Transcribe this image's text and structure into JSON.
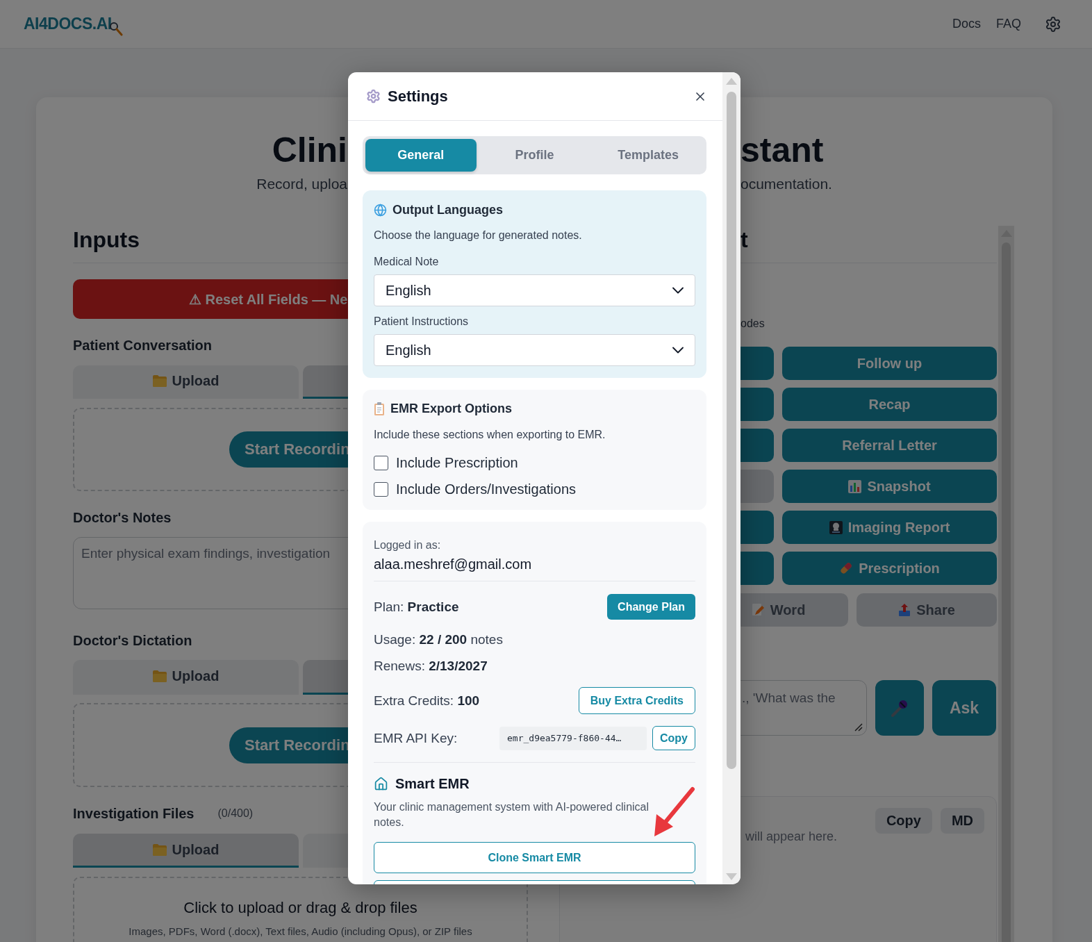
{
  "header": {
    "logo": "AI4DOCS.AI",
    "nav": [
      "Docs",
      "FAQ"
    ]
  },
  "page": {
    "title_left": "Clini",
    "title_right": "stant",
    "subtitle_left": "Record, uploa",
    "subtitle_right": "ocumentation."
  },
  "inputs": {
    "heading": "Inputs",
    "reset_button": "⚠ Reset All Fields — Ne",
    "sections": [
      {
        "kind": "recorder",
        "title": "Patient Conversation",
        "tabs": [
          {
            "label": "Upload",
            "selected": false
          },
          {
            "selected": true
          }
        ],
        "record_button": "Start Recordin"
      },
      {
        "kind": "notes",
        "title": "Doctor's Notes",
        "placeholder": "Enter physical exam findings, investigation"
      },
      {
        "kind": "recorder",
        "title": "Doctor's Dictation",
        "tabs": [
          {
            "label": "Upload",
            "selected": false
          },
          {
            "selected": true
          }
        ],
        "record_button": "Start Recordin"
      },
      {
        "kind": "files",
        "title": "Investigation Files",
        "count": "(0/400)",
        "tabs": [
          {
            "label": "Upload",
            "selected": true
          },
          {
            "selected": false
          }
        ],
        "drop_title": "Click to upload or drag & drop files",
        "drop_hint": "Images, PDFs, Word (.docx), Text files, Audio (including Opus), or ZIP files"
      }
    ]
  },
  "output": {
    "heading": "t",
    "modes_label": "odes",
    "note_buttons": [
      {
        "disabled": false
      },
      {
        "label": "Follow up",
        "disabled": false
      },
      {
        "disabled": false
      },
      {
        "label": "Recap",
        "disabled": false
      },
      {
        "disabled": false
      },
      {
        "label": "Referral Letter",
        "disabled": false
      },
      {
        "disabled": true
      },
      {
        "label": "Snapshot",
        "disabled": false
      },
      {
        "disabled": false
      },
      {
        "label": "Imaging Report",
        "disabled": false
      },
      {
        "disabled": false
      },
      {
        "label": "Prescription",
        "disabled": false
      }
    ],
    "export_buttons": [
      {
        "label": "Word",
        "disabled": true
      },
      {
        "label": "Share",
        "disabled": true
      }
    ],
    "question_placeholder": "., 'What was the",
    "ask_button": "Ask",
    "answer": {
      "placeholder": "will appear here.",
      "buttons": [
        "Copy",
        "MD"
      ]
    }
  },
  "settings": {
    "title": "Settings",
    "tabs": [
      {
        "label": "General",
        "selected": true
      },
      {
        "label": "Profile",
        "selected": false
      },
      {
        "label": "Templates",
        "selected": false
      }
    ],
    "languages": {
      "title": "Output Languages",
      "description": "Choose the language for generated notes.",
      "fields": [
        {
          "label": "Medical Note",
          "value": "English"
        },
        {
          "label": "Patient Instructions",
          "value": "English"
        }
      ]
    },
    "emr_export": {
      "title": "EMR Export Options",
      "description": "Include these sections when exporting to EMR.",
      "options": [
        {
          "label": "Include Prescription",
          "checked": false
        },
        {
          "label": "Include Orders/Investigations",
          "checked": false
        }
      ]
    },
    "account": {
      "logged_in_label": "Logged in as:",
      "email": "alaa.meshref@gmail.com",
      "plan": "Plan: **Practice**",
      "change_plan": "Change Plan",
      "usage": "Usage: **22 / 200** notes",
      "renews": "Renews: **2/13/2027**",
      "extra_credits": "Extra Credits: **100**",
      "buy_credits": "Buy Extra Credits",
      "api_key_label": "EMR API Key:",
      "api_key": "emr_d9ea5779-f860-44…",
      "copy": "Copy"
    },
    "smart_emr": {
      "title": "Smart EMR",
      "description": "Your clinic management system with AI-powered clinical notes.",
      "buttons": [
        {
          "kind": "outline",
          "label": "Clone Smart EMR"
        },
        {
          "kind": "outline"
        }
      ]
    }
  }
}
